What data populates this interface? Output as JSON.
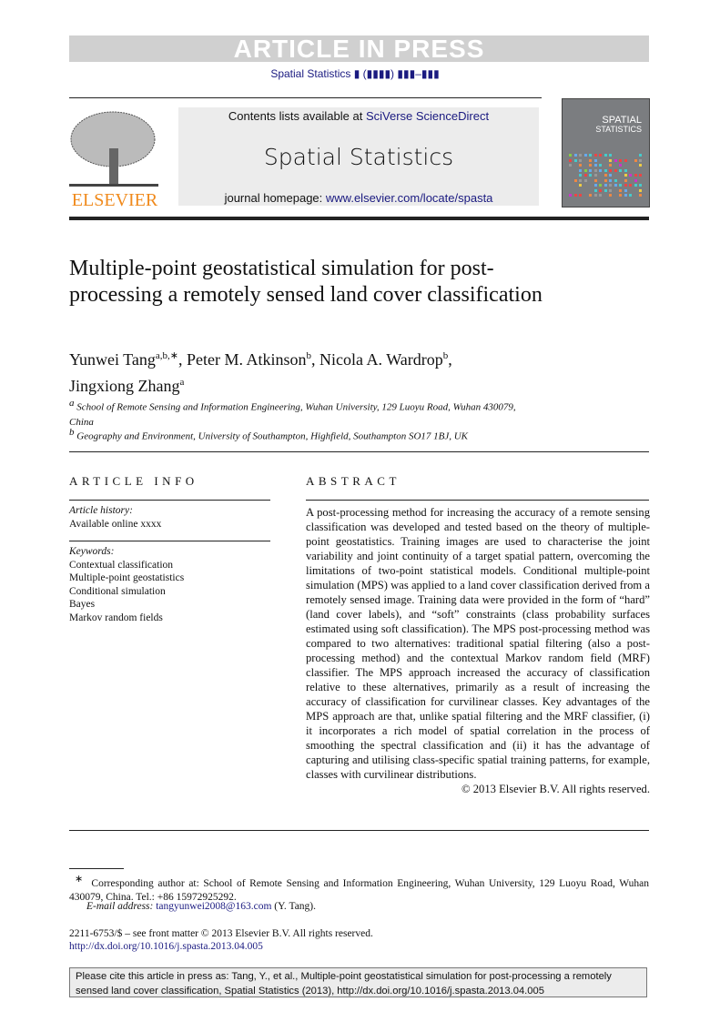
{
  "banner": "ARTICLE IN PRESS",
  "journal_ref": "Spatial Statistics ▮ (▮▮▮▮) ▮▮▮–▮▮▮",
  "header": {
    "contents_prefix": "Contents lists available at ",
    "contents_link": "SciVerse ScienceDirect",
    "journal_title": "Spatial Statistics",
    "homepage_prefix": "journal homepage: ",
    "homepage_link": "www.elsevier.com/locate/spasta",
    "publisher_logo": "ELSEVIER",
    "cover_title_1": "SPATIAL",
    "cover_title_2": "STATISTICS"
  },
  "title": "Multiple-point geostatistical simulation for post-processing a remotely sensed land cover classification",
  "authors": [
    {
      "name": "Yunwei Tang",
      "sup": "a,b,∗",
      "sep": ", "
    },
    {
      "name": "Peter M. Atkinson",
      "sup": "b",
      "sep": ", "
    },
    {
      "name": "Nicola A. Wardrop",
      "sup": "b",
      "sep": ","
    },
    {
      "name": "Jingxiong Zhang",
      "sup": "a",
      "sep": ""
    }
  ],
  "affiliations": [
    {
      "mark": "a",
      "text": "School of Remote Sensing and Information Engineering, Wuhan University, 129 Luoyu Road, Wuhan 430079, China"
    },
    {
      "mark": "b",
      "text": "Geography and Environment, University of Southampton, Highfield, Southampton SO17 1BJ, UK"
    }
  ],
  "article_info": {
    "heading": "ARTICLE INFO",
    "history_label": "Article history:",
    "history": "Available online xxxx",
    "keywords_label": "Keywords:",
    "keywords": [
      "Contextual classification",
      "Multiple-point geostatistics",
      "Conditional simulation",
      "Bayes",
      "Markov random fields"
    ]
  },
  "abstract": {
    "heading": "ABSTRACT",
    "text": "A post-processing method for increasing the accuracy of a remote sensing classification was developed and tested based on the theory of multiple-point geostatistics. Training images are used to characterise the joint variability and joint continuity of a target spatial pattern, overcoming the limitations of two-point statistical models. Conditional multiple-point simulation (MPS) was applied to a land cover classification derived from a remotely sensed image. Training data were provided in the form of “hard” (land cover labels), and “soft” constraints (class probability surfaces estimated using soft classification). The MPS post-processing method was compared to two alternatives: traditional spatial filtering (also a post-processing method) and the contextual Markov random field (MRF) classifier. The MPS approach increased the accuracy of classification relative to these alternatives, primarily as a result of increasing the accuracy of classification for curvilinear classes. Key advantages of the MPS approach are that, unlike spatial filtering and the MRF classifier, (i) it incorporates a rich model of spatial correlation in the process of smoothing the spectral classification and (ii) it has the advantage of capturing and utilising class-specific spatial training patterns, for example, classes with curvilinear distributions.",
    "copyright": "© 2013 Elsevier B.V. All rights reserved."
  },
  "footnotes": {
    "corresponding_mark": "∗",
    "corresponding": "Corresponding author at: School of Remote Sensing and Information Engineering, Wuhan University, 129 Luoyu Road, Wuhan 430079, China. Tel.: +86 15972925292.",
    "email_label": "E-mail address:",
    "email": "tangyunwei2008@163.com",
    "email_suffix": " (Y. Tang).",
    "front_matter": "2211-6753/$ – see front matter © 2013 Elsevier B.V. All rights reserved.",
    "doi": "http://dx.doi.org/10.1016/j.spasta.2013.04.005"
  },
  "cite_box": "Please cite this article in press as: Tang, Y., et al., Multiple-point geostatistical simulation for post-processing a remotely sensed land cover classification, Spatial Statistics (2013), http://dx.doi.org/10.1016/j.spasta.2013.04.005"
}
